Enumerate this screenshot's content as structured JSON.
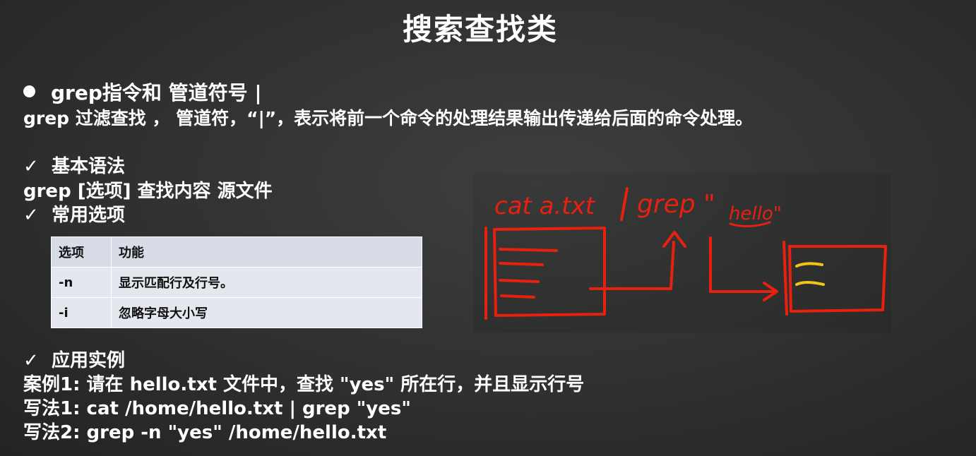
{
  "title": "搜索查找类",
  "bullet": {
    "heading": "grep指令和 管道符号 |",
    "description": "grep 过滤查找 ， 管道符，“|”，表示将前一个命令的处理结果输出传递给后面的命令处理。"
  },
  "check_mark": "✓",
  "basic_syntax": {
    "heading": "基本语法",
    "syntax": "grep [选项] 查找内容 源文件"
  },
  "common_options": {
    "heading": "常用选项",
    "columns": [
      "选项",
      "功能"
    ],
    "rows": [
      [
        "-n",
        "显示匹配行及行号。"
      ],
      [
        "-i",
        "忽略字母大小写"
      ]
    ]
  },
  "examples": {
    "heading": "应用实例",
    "lines": [
      "案例1: 请在 hello.txt 文件中，查找  \"yes\"  所在行，并且显示行号",
      "写法1:  cat /home/hello.txt   | grep  \"yes\"",
      "写法2: grep -n \"yes\" /home/hello.txt"
    ]
  },
  "sketch": {
    "handwriting": "cat a.txt | grep \"hello\"",
    "ink_color": "#e8200f",
    "highlight_color": "#f2c418"
  }
}
